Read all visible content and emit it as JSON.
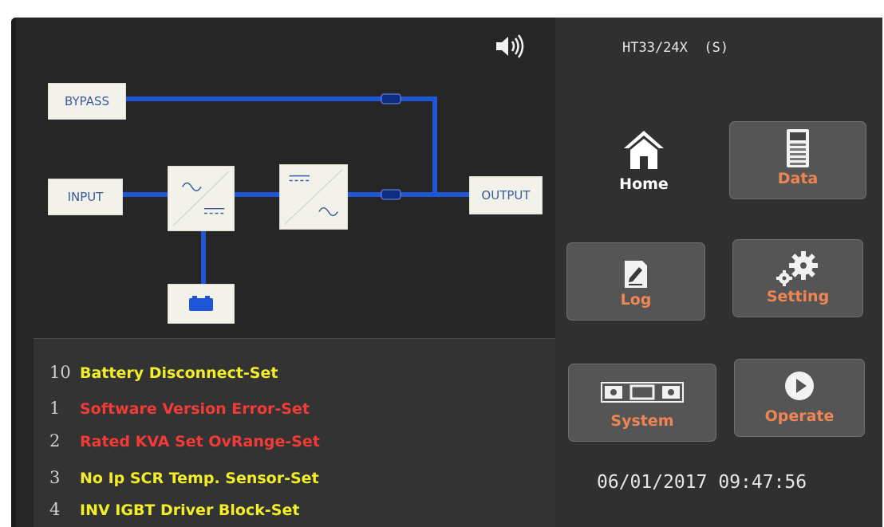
{
  "header": {
    "model": "HT33/24X  (S)",
    "speaker_icon": "speaker-volume-icon"
  },
  "diagram": {
    "bypass_label": "BYPASS",
    "input_label": "INPUT",
    "output_label": "OUTPUT",
    "rectifier_icon": "ac-to-dc-icon",
    "inverter_icon": "dc-to-ac-icon",
    "battery_icon": "battery-icon",
    "line_color": "#1f56d6"
  },
  "nav": {
    "home": {
      "label": "Home",
      "icon": "house-icon"
    },
    "data": {
      "label": "Data",
      "icon": "data-meter-icon"
    },
    "log": {
      "label": "Log",
      "icon": "edit-document-icon"
    },
    "setting": {
      "label": "Setting",
      "icon": "gears-icon"
    },
    "system": {
      "label": "System",
      "icon": "system-panel-icon"
    },
    "operate": {
      "label": "Operate",
      "icon": "play-icon"
    },
    "label_color": "#ef8552"
  },
  "alarms": [
    {
      "num": "10",
      "text": "Battery Disconnect-Set",
      "color": "#f2ef2a"
    },
    {
      "num": "1",
      "text": "Software Version Error-Set",
      "color": "#f23a37"
    },
    {
      "num": "2",
      "text": "Rated KVA Set OvRange-Set",
      "color": "#f23a37"
    },
    {
      "num": "3",
      "text": "No Ip SCR Temp. Sensor-Set",
      "color": "#f2ef2a"
    },
    {
      "num": "4",
      "text": "INV IGBT Driver Block-Set",
      "color": "#f2ef2a"
    }
  ],
  "datetime": {
    "date": "06/01/2017",
    "time": "09:47:56"
  }
}
